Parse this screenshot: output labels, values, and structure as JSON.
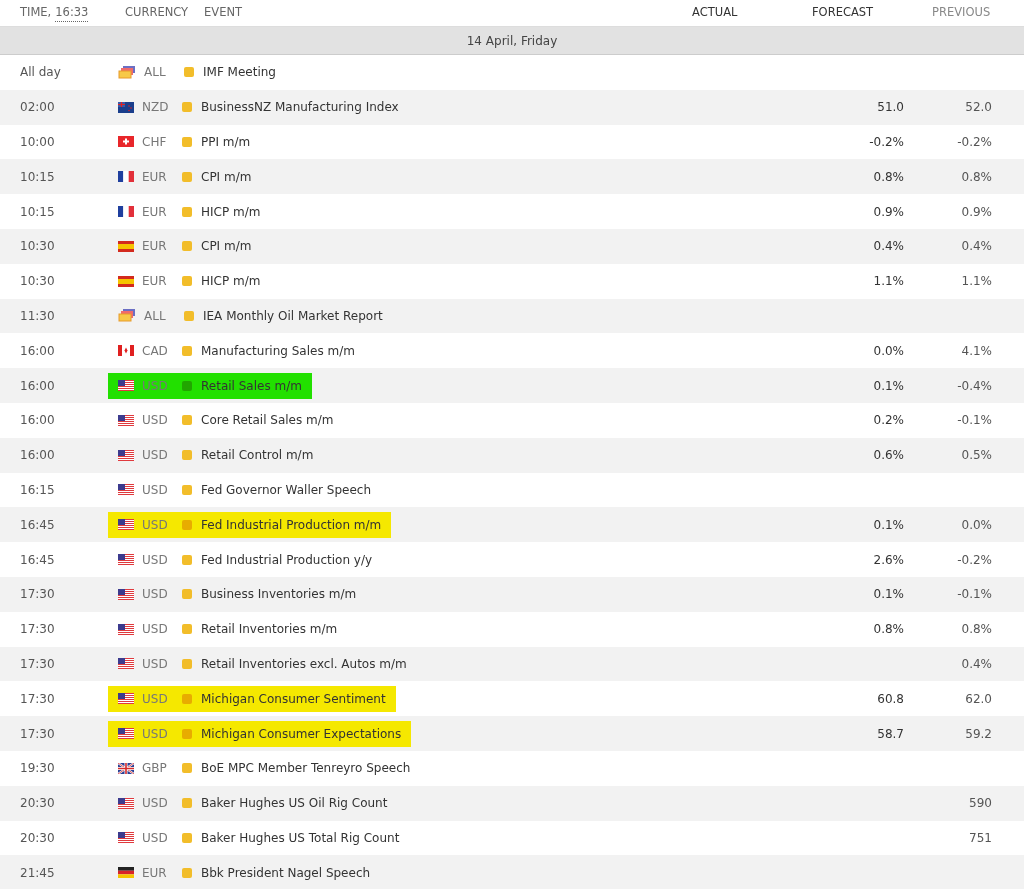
{
  "header": {
    "time_label": "TIME,",
    "time_value": "16:33",
    "columns": [
      "CURRENCY",
      "EVENT",
      "ACTUAL",
      "FORECAST",
      "PREVIOUS"
    ]
  },
  "date": "14 April, Friday",
  "rows": [
    {
      "time": "All day",
      "kind": "multi",
      "currency": "ALL",
      "event": "IMF Meeting"
    },
    {
      "time": "02:00",
      "kind": "nz",
      "currency": "NZD",
      "event": "BusinessNZ Manufacturing Index",
      "forecast": "51.0",
      "previous": "52.0"
    },
    {
      "time": "10:00",
      "kind": "ch",
      "currency": "CHF",
      "event": "PPI m/m",
      "forecast": "-0.2%",
      "previous": "-0.2%"
    },
    {
      "time": "10:15",
      "kind": "fr",
      "currency": "EUR",
      "event": "CPI m/m",
      "forecast": "0.8%",
      "previous": "0.8%"
    },
    {
      "time": "10:15",
      "kind": "fr",
      "currency": "EUR",
      "event": "HICP m/m",
      "forecast": "0.9%",
      "previous": "0.9%"
    },
    {
      "time": "10:30",
      "kind": "es",
      "currency": "EUR",
      "event": "CPI m/m",
      "forecast": "0.4%",
      "previous": "0.4%"
    },
    {
      "time": "10:30",
      "kind": "es",
      "currency": "EUR",
      "event": "HICP m/m",
      "forecast": "1.1%",
      "previous": "1.1%"
    },
    {
      "time": "11:30",
      "kind": "multi",
      "currency": "ALL",
      "event": "IEA Monthly Oil Market Report"
    },
    {
      "time": "16:00",
      "kind": "ca",
      "currency": "CAD",
      "event": "Manufacturing Sales m/m",
      "forecast": "0.0%",
      "previous": "4.1%"
    },
    {
      "time": "16:00",
      "kind": "us",
      "currency": "USD",
      "event": "Retail Sales m/m",
      "forecast": "0.1%",
      "previous": "-0.4%",
      "color": "#22e000"
    },
    {
      "time": "16:00",
      "kind": "us",
      "currency": "USD",
      "event": "Core Retail Sales m/m",
      "forecast": "0.2%",
      "previous": "-0.1%"
    },
    {
      "time": "16:00",
      "kind": "us",
      "currency": "USD",
      "event": "Retail Control m/m",
      "forecast": "0.6%",
      "previous": "0.5%"
    },
    {
      "time": "16:15",
      "kind": "us",
      "currency": "USD",
      "event": "Fed Governor Waller Speech"
    },
    {
      "time": "16:45",
      "kind": "us",
      "currency": "USD",
      "event": "Fed Industrial Production m/m",
      "forecast": "0.1%",
      "previous": "0.0%",
      "color": "#f5e800"
    },
    {
      "time": "16:45",
      "kind": "us",
      "currency": "USD",
      "event": "Fed Industrial Production y/y",
      "forecast": "2.6%",
      "previous": "-0.2%"
    },
    {
      "time": "17:30",
      "kind": "us",
      "currency": "USD",
      "event": "Business Inventories m/m",
      "forecast": "0.1%",
      "previous": "-0.1%"
    },
    {
      "time": "17:30",
      "kind": "us",
      "currency": "USD",
      "event": "Retail Inventories m/m",
      "forecast": "0.8%",
      "previous": "0.8%"
    },
    {
      "time": "17:30",
      "kind": "us",
      "currency": "USD",
      "event": "Retail Inventories excl. Autos m/m",
      "previous": "0.4%"
    },
    {
      "time": "17:30",
      "kind": "us",
      "currency": "USD",
      "event": "Michigan Consumer Sentiment",
      "forecast": "60.8",
      "previous": "62.0",
      "color": "#f5e800"
    },
    {
      "time": "17:30",
      "kind": "us",
      "currency": "USD",
      "event": "Michigan Consumer Expectations",
      "forecast": "58.7",
      "previous": "59.2",
      "color": "#f5e800"
    },
    {
      "time": "19:30",
      "kind": "gb",
      "currency": "GBP",
      "event": "BoE MPC Member Tenreyro Speech"
    },
    {
      "time": "20:30",
      "kind": "us",
      "currency": "USD",
      "event": "Baker Hughes US Oil Rig Count",
      "previous": "590"
    },
    {
      "time": "20:30",
      "kind": "us",
      "currency": "USD",
      "event": "Baker Hughes US Total Rig Count",
      "previous": "751"
    },
    {
      "time": "21:45",
      "kind": "de",
      "currency": "EUR",
      "event": "Bbk President Nagel Speech"
    }
  ]
}
